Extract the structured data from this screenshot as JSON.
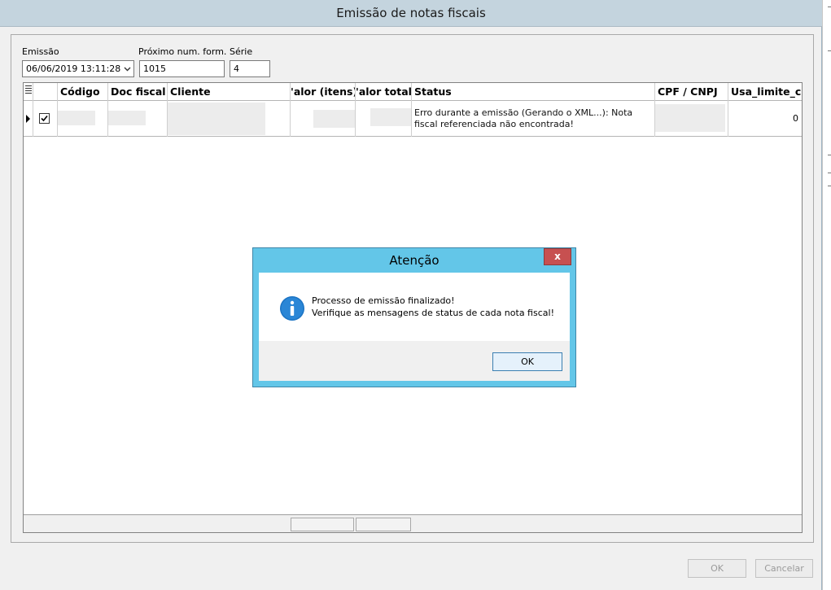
{
  "window": {
    "title": "Emissão de notas fiscais"
  },
  "form": {
    "emissao_label": "Emissão",
    "emissao_value": "06/06/2019 13:11:28",
    "proximo_label": "Próximo num. form.",
    "proximo_value": "1015",
    "serie_label": "Série",
    "serie_value": "4"
  },
  "grid": {
    "columns": [
      "Código",
      "Doc fiscal",
      "Cliente",
      "'alor (itens)",
      "'alor total",
      "Status",
      "CPF / CNPJ",
      "Usa_limite_cr"
    ],
    "rows": [
      {
        "checked": true,
        "status": "Erro durante a emissão (Gerando o XML...): Nota fiscal referenciada não encontrada!",
        "usa_limite": "0"
      }
    ]
  },
  "dialog": {
    "title": "Atenção",
    "close_label": "x",
    "message_line1": "Processo de emissão finalizado!",
    "message_line2": "Verifique as mensagens de status de cada nota fiscal!",
    "ok_label": "OK"
  },
  "buttons": {
    "ok_label": "OK",
    "cancel_label": "Cancelar"
  },
  "colors": {
    "dialog_accent": "#63c6e8",
    "close_button": "#c75050",
    "titlebar": "#c4d4de"
  }
}
